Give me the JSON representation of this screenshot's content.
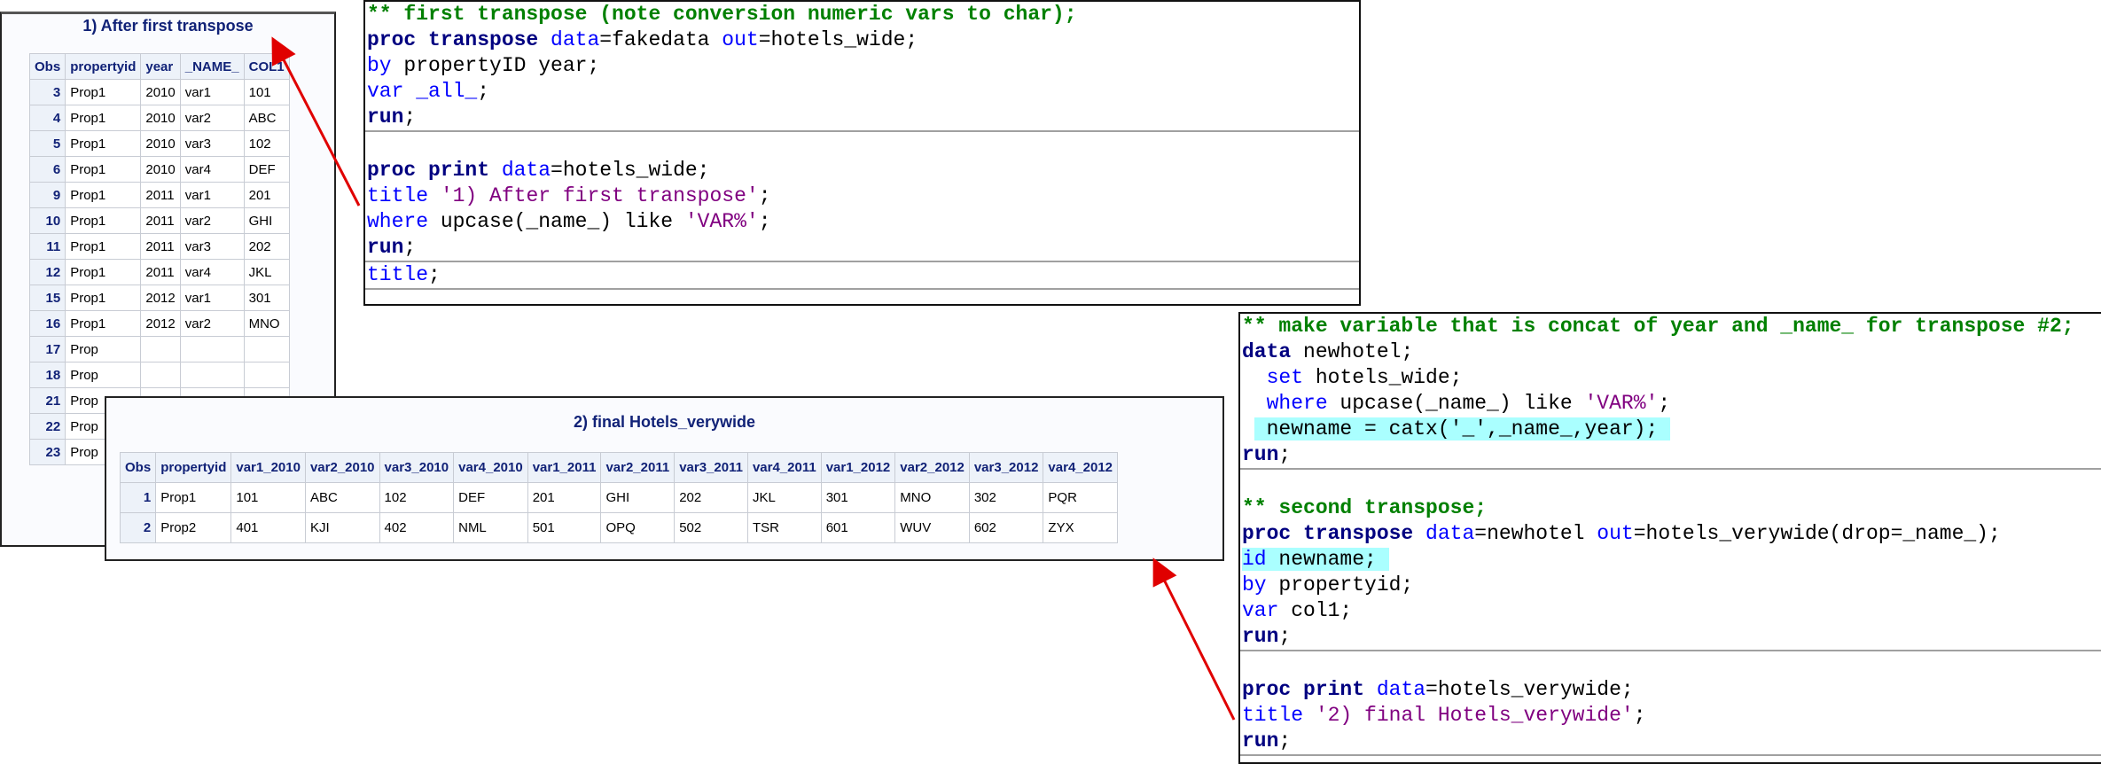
{
  "output1": {
    "title": "1) After first transpose",
    "columns": [
      "Obs",
      "propertyid",
      "year",
      "_NAME_",
      "COL1"
    ],
    "rows": [
      [
        "3",
        "Prop1",
        "2010",
        "var1",
        "101"
      ],
      [
        "4",
        "Prop1",
        "2010",
        "var2",
        "ABC"
      ],
      [
        "5",
        "Prop1",
        "2010",
        "var3",
        "102"
      ],
      [
        "6",
        "Prop1",
        "2010",
        "var4",
        "DEF"
      ],
      [
        "9",
        "Prop1",
        "2011",
        "var1",
        "201"
      ],
      [
        "10",
        "Prop1",
        "2011",
        "var2",
        "GHI"
      ],
      [
        "11",
        "Prop1",
        "2011",
        "var3",
        "202"
      ],
      [
        "12",
        "Prop1",
        "2011",
        "var4",
        "JKL"
      ],
      [
        "15",
        "Prop1",
        "2012",
        "var1",
        "301"
      ],
      [
        "16",
        "Prop1",
        "2012",
        "var2",
        "MNO"
      ],
      [
        "17",
        "Prop",
        "",
        "",
        ""
      ],
      [
        "18",
        "Prop",
        "",
        "",
        ""
      ],
      [
        "21",
        "Prop",
        "",
        "",
        ""
      ],
      [
        "22",
        "Prop",
        "",
        "",
        ""
      ],
      [
        "23",
        "Prop",
        "",
        "",
        ""
      ]
    ]
  },
  "output2": {
    "title": "2) final Hotels_verywide",
    "columns": [
      "Obs",
      "propertyid",
      "var1_2010",
      "var2_2010",
      "var3_2010",
      "var4_2010",
      "var1_2011",
      "var2_2011",
      "var3_2011",
      "var4_2011",
      "var1_2012",
      "var2_2012",
      "var3_2012",
      "var4_2012"
    ],
    "rows": [
      [
        "1",
        "Prop1",
        "101",
        "ABC",
        "102",
        "DEF",
        "201",
        "GHI",
        "202",
        "JKL",
        "301",
        "MNO",
        "302",
        "PQR"
      ],
      [
        "2",
        "Prop2",
        "401",
        "KJI",
        "402",
        "NML",
        "501",
        "OPQ",
        "502",
        "TSR",
        "601",
        "WUV",
        "602",
        "ZYX"
      ]
    ]
  },
  "code1": {
    "sections": [
      [
        [
          [
            "** first transpose (note conversion numeric vars to char);",
            "cm"
          ]
        ],
        [
          [
            "proc transpose ",
            "kw"
          ],
          [
            "data",
            "bl"
          ],
          [
            "=fakedata ",
            "tx"
          ],
          [
            "out",
            "bl"
          ],
          [
            "=hotels_wide;",
            "tx"
          ]
        ],
        [
          [
            "by",
            "bl"
          ],
          [
            " propertyID year;",
            "tx"
          ]
        ],
        [
          [
            "var _all_",
            "bl"
          ],
          [
            ";",
            "tx"
          ]
        ],
        [
          [
            "run",
            "kw"
          ],
          [
            ";",
            "tx"
          ]
        ]
      ],
      [
        [
          [
            "",
            ""
          ]
        ],
        [
          [
            "proc print ",
            "kw"
          ],
          [
            "data",
            "bl"
          ],
          [
            "=hotels_wide;",
            "tx"
          ]
        ],
        [
          [
            "title ",
            "bl"
          ],
          [
            "'1) After first transpose'",
            "st"
          ],
          [
            ";",
            "tx"
          ]
        ],
        [
          [
            "where",
            "bl"
          ],
          [
            " upcase(_name_) like ",
            "tx"
          ],
          [
            "'VAR%'",
            "st"
          ],
          [
            ";",
            "tx"
          ]
        ],
        [
          [
            "run",
            "kw"
          ],
          [
            ";",
            "tx"
          ]
        ]
      ],
      [
        [
          [
            "title",
            "bl"
          ],
          [
            ";",
            "tx"
          ]
        ]
      ]
    ]
  },
  "code2": {
    "sections": [
      [
        [
          [
            "** make variable that is concat of year and _name_ for transpose #2;",
            "cm"
          ]
        ],
        [
          [
            "data",
            "kw"
          ],
          [
            " newhotel;",
            "tx"
          ]
        ],
        [
          [
            "  ",
            "tx"
          ],
          [
            "set",
            "bl"
          ],
          [
            " hotels_wide;",
            "tx"
          ]
        ],
        [
          [
            "  ",
            "tx"
          ],
          [
            "where",
            "bl"
          ],
          [
            " upcase(_name_) like ",
            "tx"
          ],
          [
            "'VAR%'",
            "st"
          ],
          [
            ";",
            "tx"
          ]
        ],
        [
          [
            " ",
            "tx"
          ],
          [
            " newname = catx('_',_name_,year); ",
            "tx hl"
          ]
        ],
        [
          [
            "run",
            "kw"
          ],
          [
            ";",
            "tx"
          ]
        ]
      ],
      [
        [
          [
            "",
            ""
          ]
        ],
        [
          [
            "** second transpose;",
            "cm"
          ]
        ],
        [
          [
            "proc transpose ",
            "kw"
          ],
          [
            "data",
            "bl"
          ],
          [
            "=newhotel ",
            "tx"
          ],
          [
            "out",
            "bl"
          ],
          [
            "=hotels_verywide(drop=_name_);",
            "tx"
          ]
        ],
        [
          [
            "id",
            "bl hl"
          ],
          [
            " newname; ",
            "tx hl"
          ]
        ],
        [
          [
            "by",
            "bl"
          ],
          [
            " propertyid;",
            "tx"
          ]
        ],
        [
          [
            "var",
            "bl"
          ],
          [
            " col1;",
            "tx"
          ]
        ],
        [
          [
            "run",
            "kw"
          ],
          [
            ";",
            "tx"
          ]
        ]
      ],
      [
        [
          [
            "",
            ""
          ]
        ],
        [
          [
            "proc print ",
            "kw"
          ],
          [
            "data",
            "bl"
          ],
          [
            "=hotels_verywide;",
            "tx"
          ]
        ],
        [
          [
            "title ",
            "bl"
          ],
          [
            "'2) final Hotels_verywide'",
            "st"
          ],
          [
            ";",
            "tx"
          ]
        ],
        [
          [
            "run",
            "kw"
          ],
          [
            ";",
            "tx"
          ]
        ]
      ]
    ]
  },
  "colors": {
    "header_bg": "#edf2f9",
    "header_text": "#112277",
    "comment": "#008000",
    "keyword": "#000080",
    "option": "#0000ff",
    "string": "#800080",
    "highlight": "#aaffff",
    "arrow": "#e00000"
  }
}
